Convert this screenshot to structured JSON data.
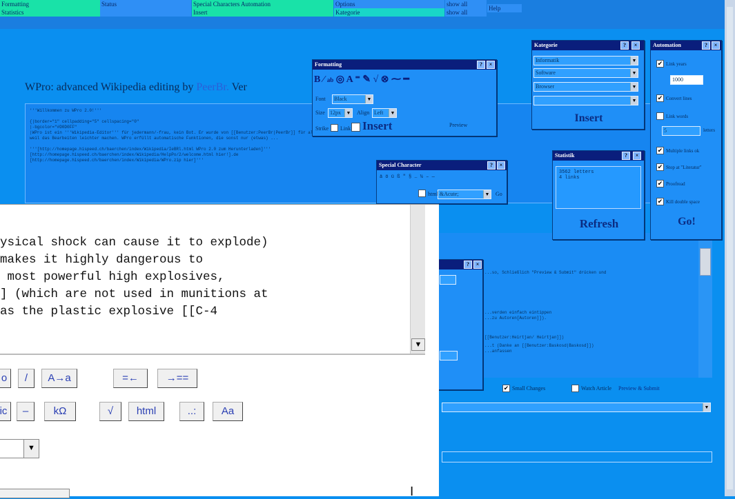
{
  "menu": {
    "formatting": "Formatting",
    "statistics": "Statistics",
    "status": "Status",
    "special_chars_automation": "Special Characters Automation",
    "insert": "Insert",
    "options": "Options",
    "kategorie": "Kategorie",
    "show_all_1": "show all",
    "show_all_2": "show all",
    "help": "Help"
  },
  "title": {
    "prefix": "WPro: advanced Wikipedia editing by ",
    "author": "PeerBr.",
    "suffix": " Ver"
  },
  "wikitext_lines": [
    "'''Willkommen zu WPro 2.0!'''",
    "",
    "{|border=\"1\" cellpadding=\"5\" cellspacing=\"0\"",
    "|-bgcolor=\"#D0D0FF\"",
    "|WPro ist ein '''Wikipedia-Editor''' für jedermann/-frau, kein Bot. Er wurde von [[Benutzer:PeerBr|PeerBr]] für alle Benutzer",
    "weil das Bearbeiten leichter machen. WPro erfüllt automatische Funktionen, die sonst nur (etwas) ...",
    "",
    "'''[http://homepage.hispeed.ch/baerchen/index/Wikipedia/IeBRl.html WPro 2.0 zum Herunterladen]'''",
    "[http://homepage.hispeed.ch/baerchen/index/Wikipedia/HelpPo/2/welcome.html hier!].de",
    "[http://homepage.hispeed.ch/baerchen/index/Wikipedia/WPro.zip hier]'''"
  ],
  "formatting_panel": {
    "title": "Formatting",
    "font_label": "Font",
    "font_value": "Black",
    "size_label": "Size",
    "size_value": "12px",
    "align_label": "Align",
    "align_value": "Left",
    "strike_label": "Strike",
    "link_label": "Link",
    "insert_label": "Insert",
    "preview_label": "Preview",
    "toolbar_icons": "B I ab A"
  },
  "special_chars_panel": {
    "title": "Special Character",
    "chars_row": "ä ö ü ß \" § … ½ – —",
    "html_label": "html",
    "select_value": "&Acute;",
    "go_label": "Go"
  },
  "kategorie_panel": {
    "title": "Kategorie",
    "items": [
      "Informatik",
      "Software",
      "Browser",
      ""
    ],
    "insert_label": "Insert"
  },
  "statistik_panel": {
    "title": "Statistik",
    "line1": "3562 letters",
    "line2": "4 links",
    "refresh_label": "Refresh"
  },
  "automation_panel": {
    "title": "Automation",
    "options": [
      "Link years",
      "Convert lines",
      "Link words",
      "Multiple links ok",
      "Stop at \"Literatur\"",
      "Proofread",
      "Kill double space"
    ],
    "year_input": "1000",
    "words_input": "5",
    "letters_label": "letters",
    "go_label": "Go!"
  },
  "lower_lines": [
    "...so, Schließlich \"Preview & Submit\" drücken und",
    "",
    "",
    "",
    "...verden einfach eintippen",
    "...zu Autoren[Autoren]]).",
    "",
    "[[Benutzer:Heirtjan/ Heirtjan]])",
    "...t (Danke an [[Benutzer:Baskosd|Baskosd]])",
    "...anfassen"
  ],
  "submit_bar": {
    "small_changes": "Small Changes",
    "watch_article": "Watch Article",
    "preview_submit": "Preview & Submit"
  },
  "editor": {
    "lines": [
      "ysical shock can cause it to explode)",
      "makes it highly dangerous to",
      " most powerful high explosives,",
      "] (which are not used in munitions at",
      "as the plastic explosive [[C-4"
    ],
    "row1_buttons": [
      "o",
      "/",
      "A→a",
      "=←",
      "→=="
    ],
    "row2_buttons": [
      "ic",
      "–",
      "kΩ",
      "√",
      "html",
      "..:",
      "Aa"
    ],
    "scroll_down_icon": "▼",
    "select_arrow": "▼"
  }
}
